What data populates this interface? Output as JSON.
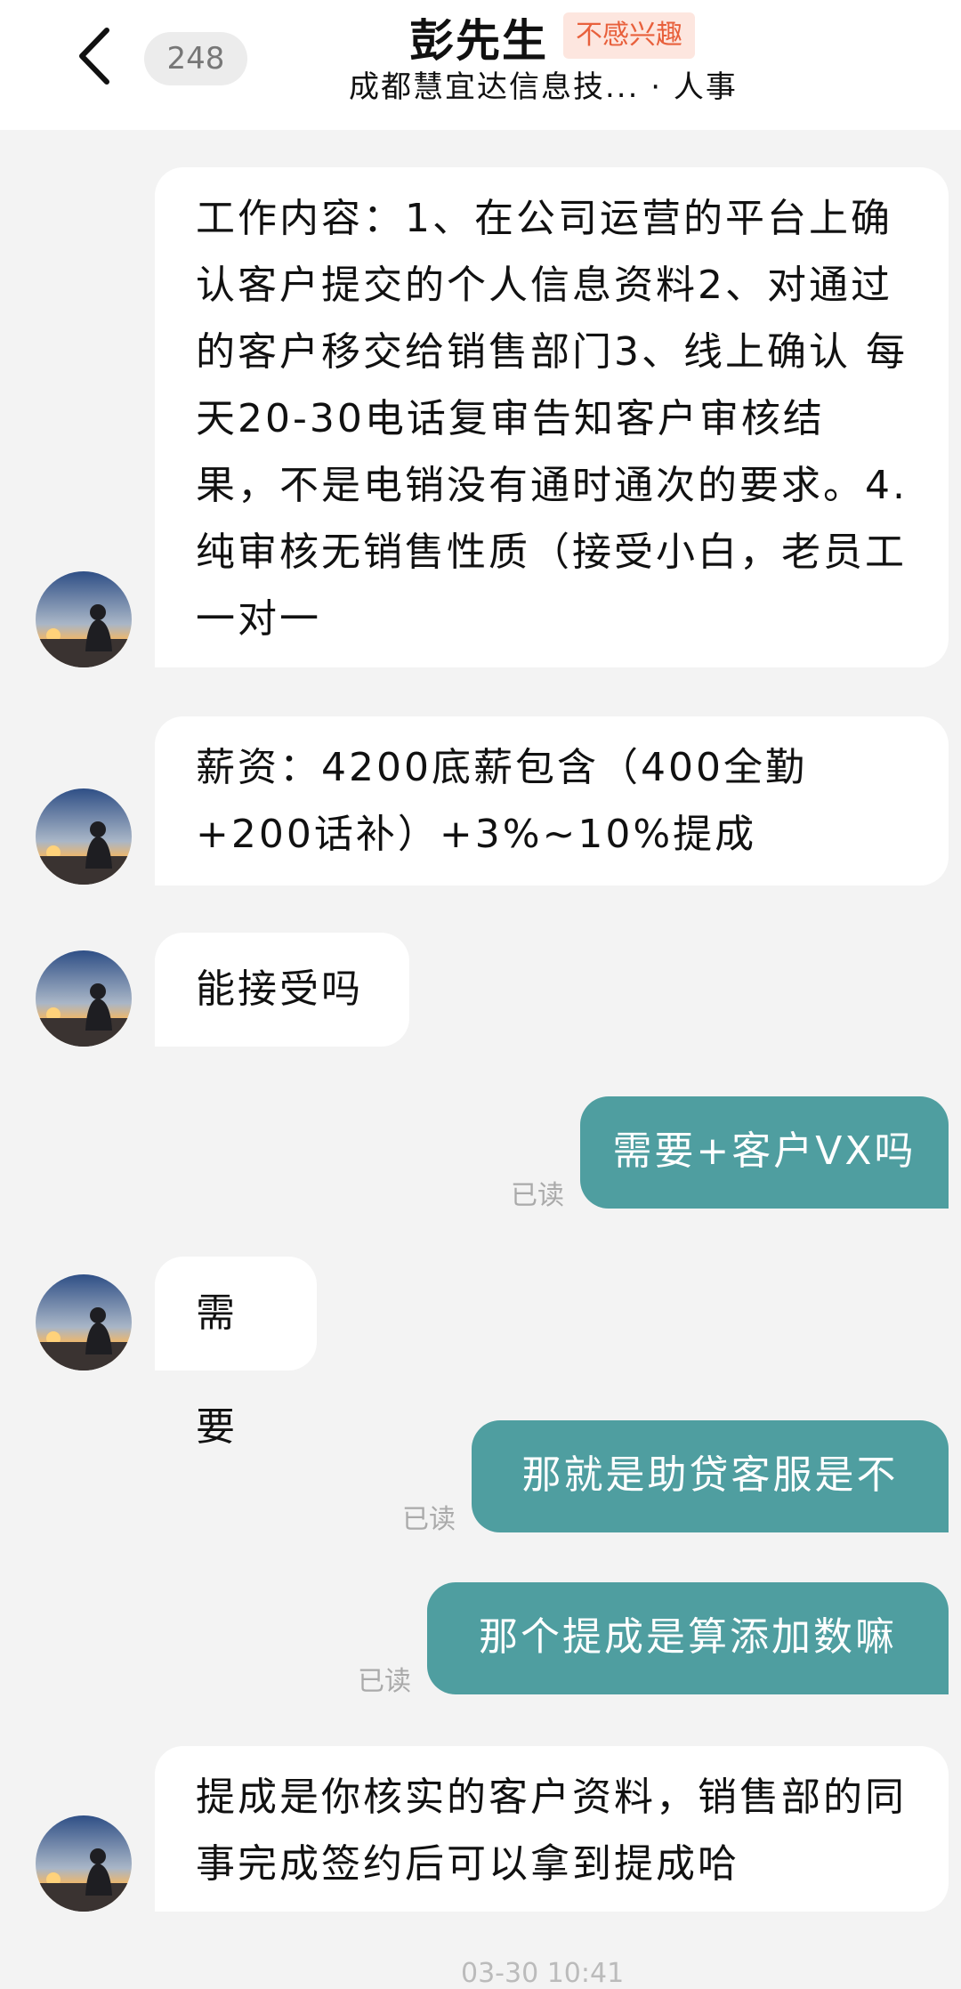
{
  "header": {
    "back_icon": "chevron-left-icon",
    "unread_count": "248",
    "contact_name": "彭先生",
    "not_interested": "不感兴趣",
    "company_role": "成都慧宜达信息技... · 人事"
  },
  "messages": [
    {
      "side": "left",
      "text": "工作内容：1、在公司运营的平台上确认客户提交的个人信息资料2、对通过的客户移交给销售部门3、线上确认 每天20-30电话复审告知客户审核结果，不是电销没有通时通次的要求。4.纯审核无销售性质（接受小白，老员工一对一"
    },
    {
      "side": "left",
      "text": "薪资：4200底薪包含（400全勤+200话补）+3%~10%提成"
    },
    {
      "side": "left",
      "text": "能接受吗"
    },
    {
      "side": "right",
      "text": "需要+客户VX吗",
      "status": "已读"
    },
    {
      "side": "left",
      "text": "需要"
    },
    {
      "side": "right",
      "text": "那就是助贷客服是不",
      "status": "已读"
    },
    {
      "side": "right",
      "text": "那个提成是算添加数嘛",
      "status": "已读"
    },
    {
      "side": "left",
      "text": "提成是你核实的客户资料，销售部的同事完成签约后可以拿到提成哈"
    }
  ],
  "footer_time": "03-30 10:41"
}
